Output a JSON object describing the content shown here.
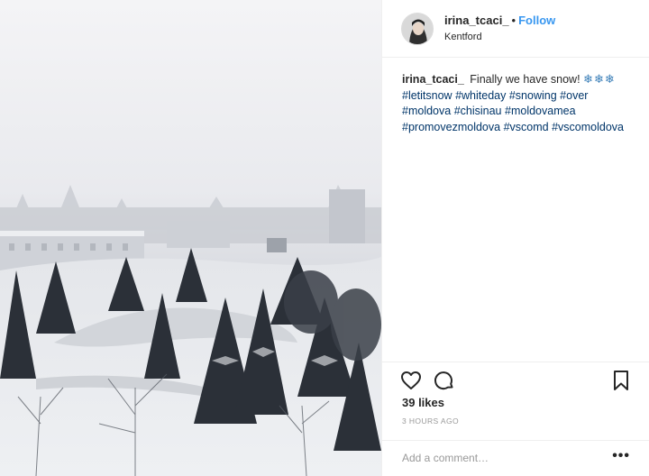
{
  "post": {
    "image_alt": "Snowy park seen from above in fog",
    "colors": {
      "accent": "#3897f0",
      "hashtag": "#003569",
      "muted": "#999999"
    }
  },
  "header": {
    "username": "irina_tcaci_",
    "separator": "•",
    "follow_label": "Follow",
    "location": "Kentford"
  },
  "caption": {
    "username": "irina_tcaci_",
    "text": "Finally we have snow!",
    "emoji": "❄❄❄",
    "hashtags": [
      "#letitsnow",
      "#whiteday",
      "#snowing",
      "#over",
      "#moldova",
      "#chisinau",
      "#moldovamea",
      "#promovezmoldova",
      "#vscomd",
      "#vscomoldova"
    ]
  },
  "actions": {
    "icons": [
      "heart-icon",
      "comment-icon",
      "bookmark-icon"
    ],
    "likes": "39 likes",
    "time": "3 HOURS AGO"
  },
  "comment": {
    "placeholder": "Add a comment…",
    "more": "•••"
  }
}
